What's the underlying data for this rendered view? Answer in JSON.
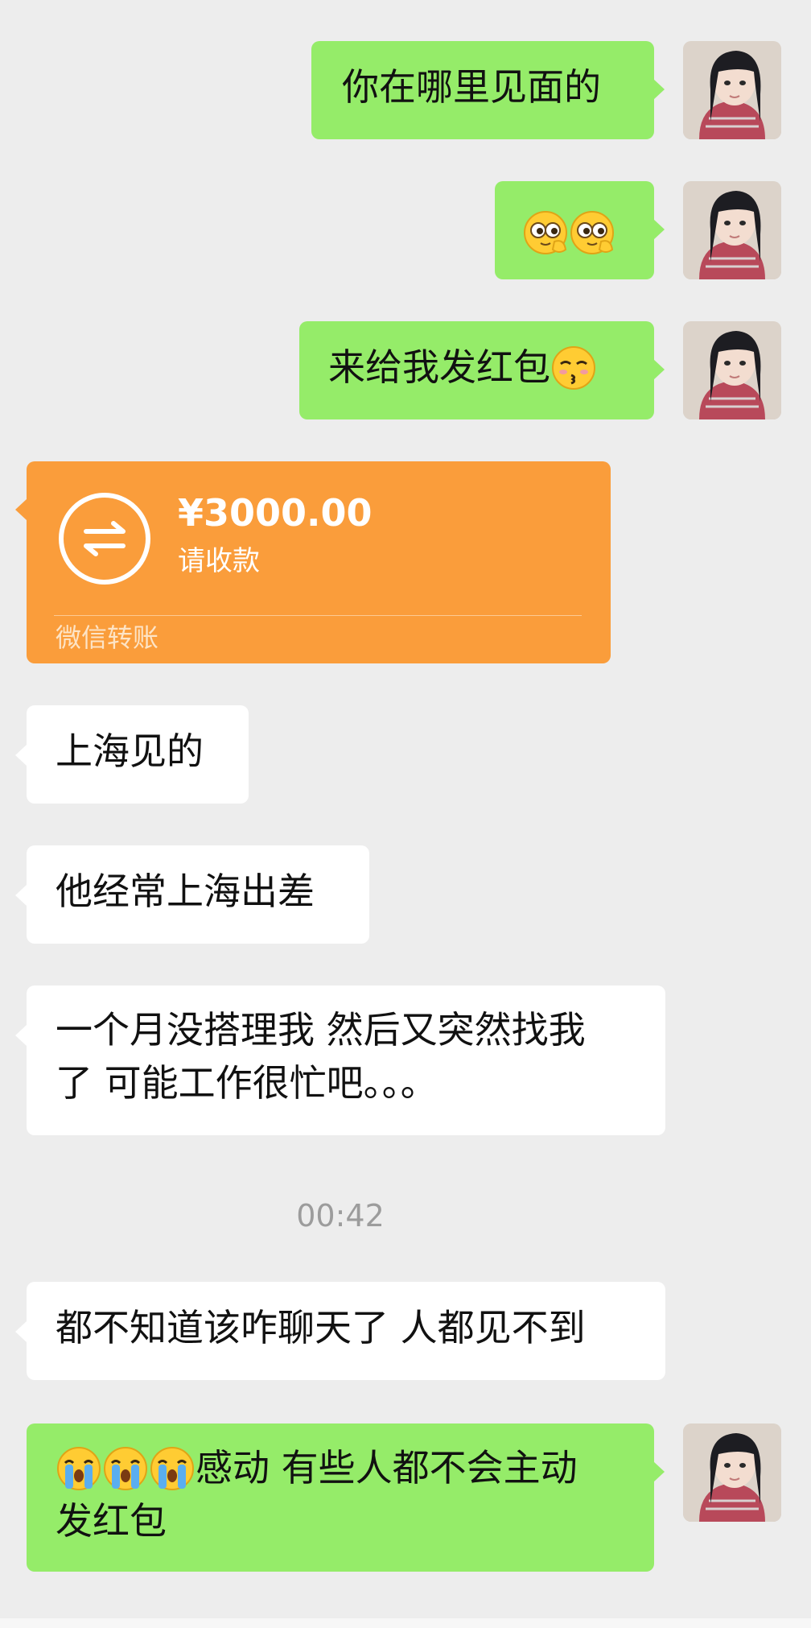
{
  "messages": [
    {
      "side": "right",
      "text": "你在哪里见面的"
    },
    {
      "side": "right",
      "emojis": [
        "peek-emoji",
        "peek-emoji"
      ]
    },
    {
      "side": "right",
      "text": "来给我发红包",
      "trailing_emoji": "kiss-emoji"
    },
    {
      "side": "left",
      "type": "transfer",
      "amount": "¥3000.00",
      "status": "请收款",
      "label": "微信转账"
    },
    {
      "side": "left",
      "text": "上海见的"
    },
    {
      "side": "left",
      "text": "他经常上海出差"
    },
    {
      "side": "left",
      "line1": "一个月没搭理我 然后又突然找我",
      "line2": "了 可能工作很忙吧。。。"
    },
    {
      "type": "timestamp",
      "text": "00:42"
    },
    {
      "side": "left",
      "text": "都不知道该咋聊天了 人都见不到"
    },
    {
      "side": "right",
      "leading_emojis": [
        "crying-emoji",
        "crying-emoji",
        "crying-emoji"
      ],
      "line1": "感动 有些人都不会主动",
      "line2": "发红包"
    }
  ],
  "colors": {
    "background": "#ededed",
    "sent_bubble": "#95ec69",
    "received_bubble": "#ffffff",
    "transfer_card": "#fa9d3b"
  }
}
